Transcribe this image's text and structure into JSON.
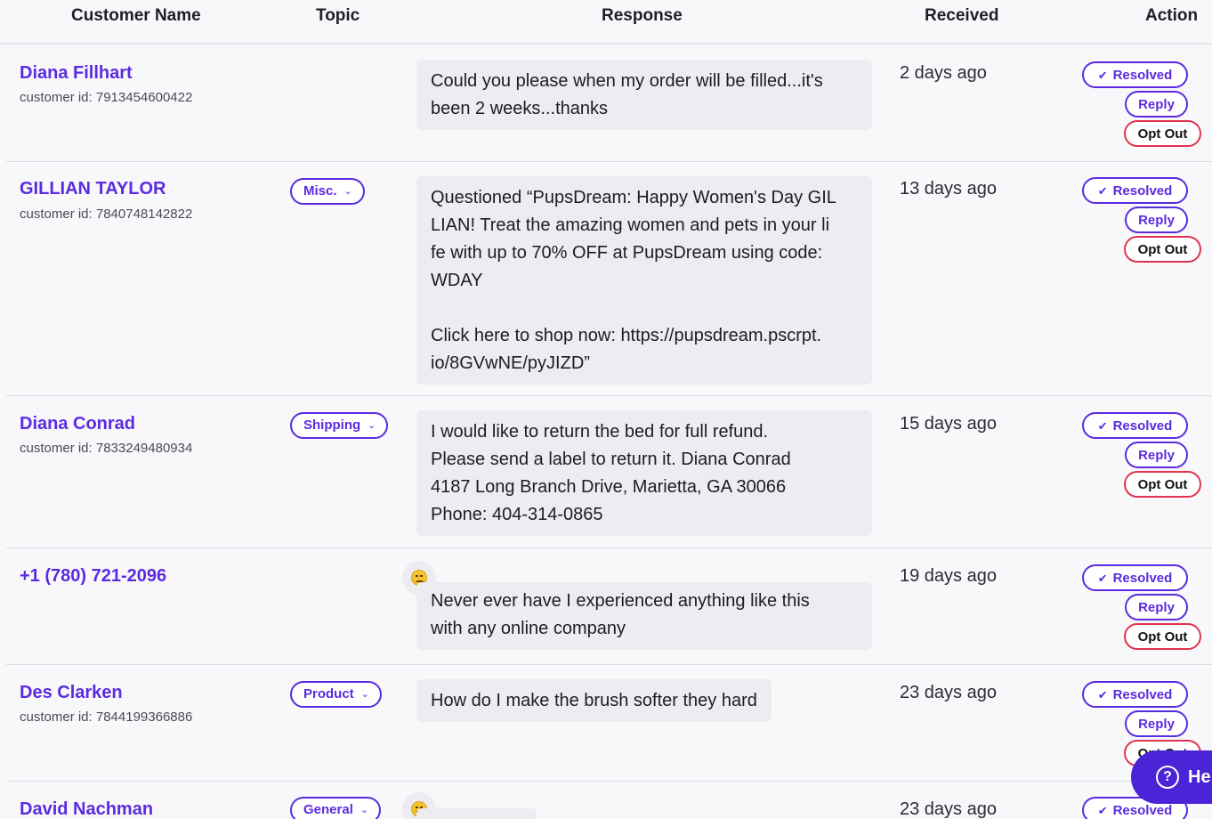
{
  "columns": {
    "customer_name": "Customer Name",
    "topic": "Topic",
    "response": "Response",
    "received": "Received",
    "action": "Action"
  },
  "actions": {
    "resolved": "Resolved",
    "reply": "Reply",
    "opt_out": "Opt Out"
  },
  "rows": [
    {
      "name": "Diana Fillhart",
      "customer_id": "customer id: 7913454600422",
      "topic": "",
      "response": "Could you please when my order will be filled...it's\nbeen 2 weeks...thanks",
      "received": "2 days ago"
    },
    {
      "name": "GILLIAN TAYLOR",
      "customer_id": "customer id: 7840748142822",
      "topic": "Misc.",
      "response": "Questioned “PupsDream: Happy Women's Day GIL\nLIAN! Treat the amazing women and pets in your li\nfe with up to 70% OFF at PupsDream using code:\nWDAY\n\nClick here to shop now: https://pupsdream.pscrpt.\nio/8GVwNE/pyJIZD”",
      "received": "13 days ago"
    },
    {
      "name": "Diana Conrad",
      "customer_id": "customer id: 7833249480934",
      "topic": "Shipping",
      "response": "I would like to return the bed for full refund.\nPlease send a label to return it.  Diana Conrad\n4187 Long Branch Drive, Marietta, GA 30066\nPhone:  404-314-0865",
      "received": "15 days ago"
    },
    {
      "name": "+1 (780) 721-2096",
      "customer_id": "",
      "topic": "",
      "sentiment": "angry-face-icon",
      "response": "Never ever have I experienced anything like this\nwith any online company",
      "received": "19 days ago"
    },
    {
      "name": "Des Clarken",
      "customer_id": "customer id: 7844199366886",
      "topic": "Product",
      "response": "How do I make the brush softer they hard",
      "received": "23 days ago"
    },
    {
      "name": "David Nachman",
      "customer_id": "",
      "topic": "General",
      "sentiment": "grinning-face-icon",
      "response": "",
      "received": "23 days ago"
    }
  ],
  "help": {
    "label": "He"
  },
  "colors": {
    "accent": "#5b2be0",
    "opt_out_border": "#e0334f",
    "help_bg": "#4a24d6"
  }
}
